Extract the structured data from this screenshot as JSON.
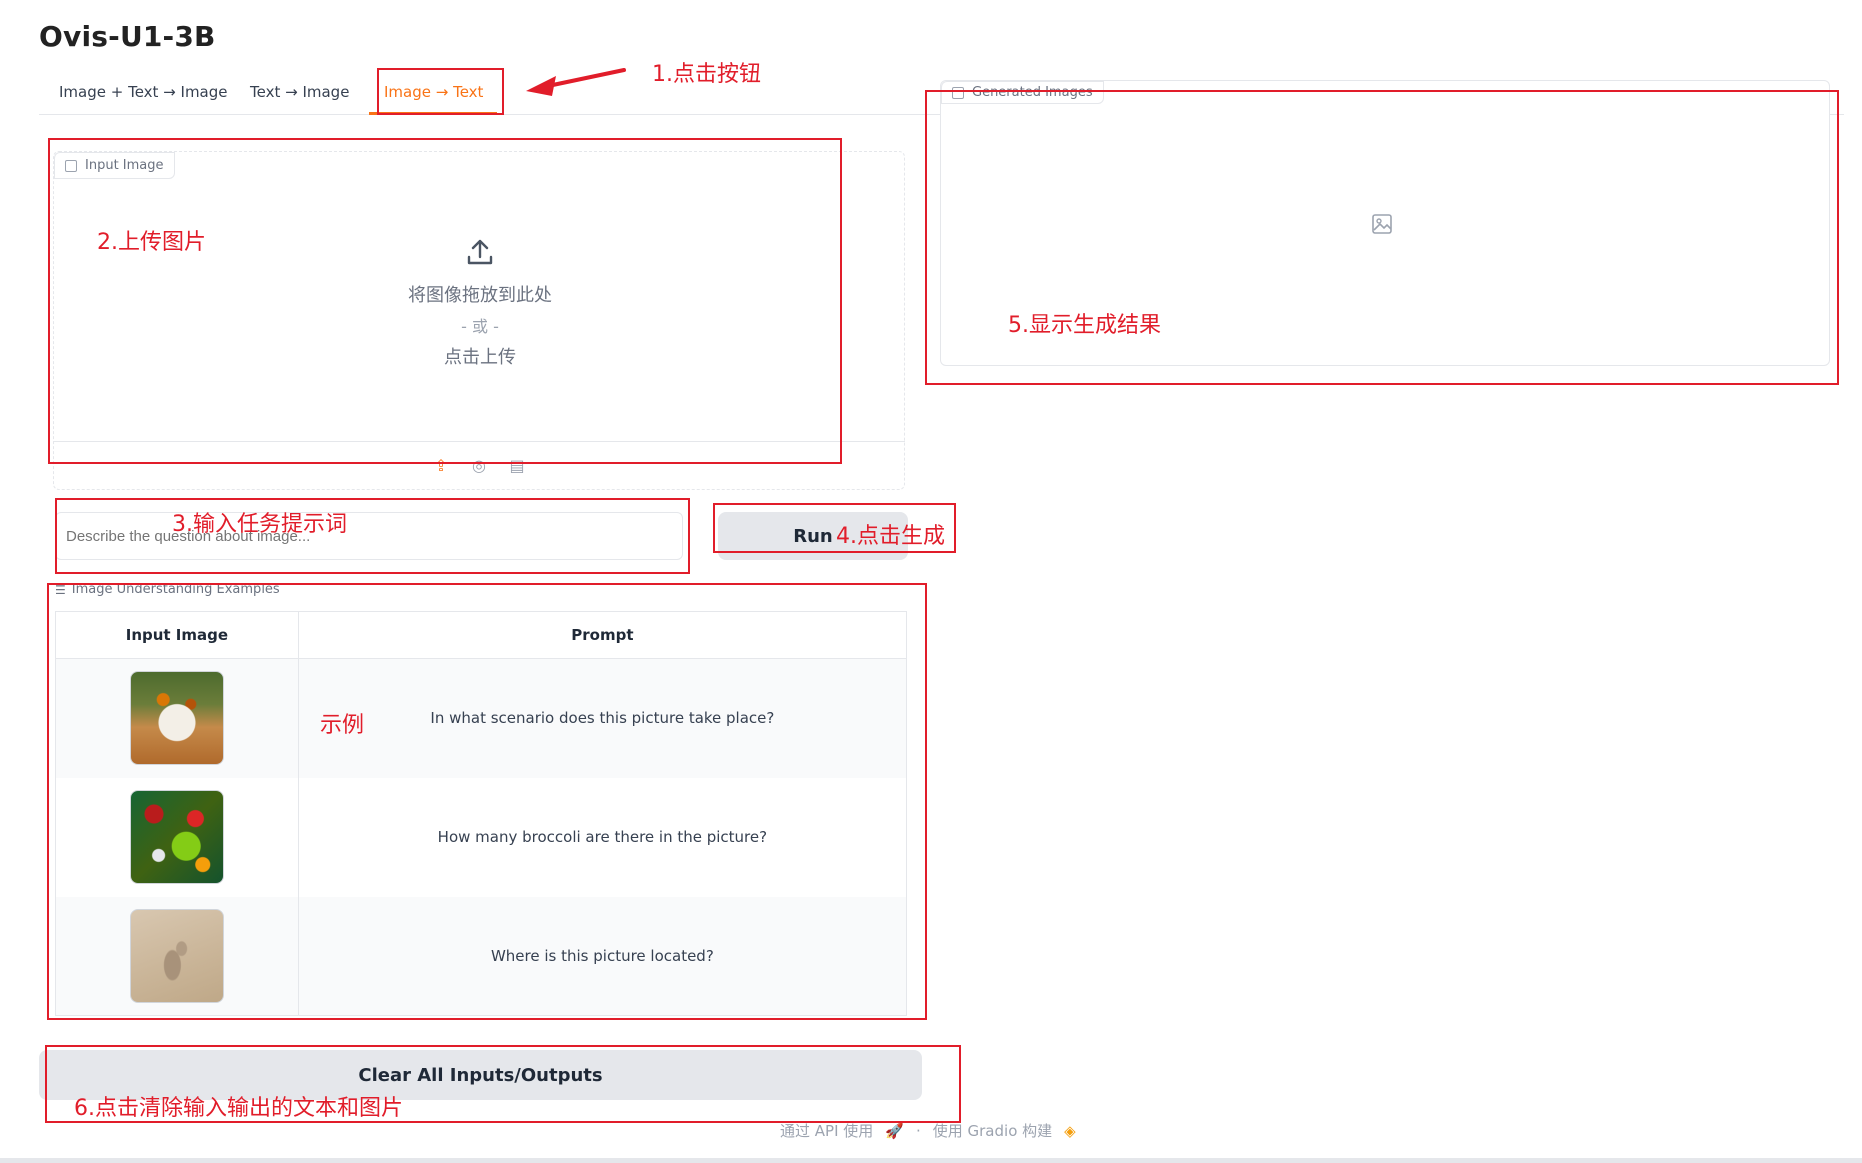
{
  "app": {
    "title": "Ovis-U1-3B"
  },
  "tabs": [
    {
      "label": "Image + Text → Image",
      "active": false
    },
    {
      "label": "Text → Image",
      "active": false
    },
    {
      "label": "Image → Text",
      "active": true
    }
  ],
  "input_panel": {
    "label": "Input Image",
    "drop_text": "将图像拖放到此处",
    "or_text": "- 或 -",
    "click_text": "点击上传"
  },
  "output_panel": {
    "label": "Generated Images"
  },
  "prompt": {
    "placeholder": "Describe the question about image..."
  },
  "run_button": {
    "label": "Run"
  },
  "examples": {
    "label": "Image Understanding Examples",
    "headers": [
      "Input Image",
      "Prompt"
    ],
    "rows": [
      {
        "image": "banquet-table-photo",
        "prompt": "In what scenario does this picture take place?"
      },
      {
        "image": "vegetables-photo",
        "prompt": "How many broccoli are there in the picture?"
      },
      {
        "image": "footprint-in-sand-photo",
        "prompt": "Where is this picture located?"
      }
    ]
  },
  "clear_button": {
    "label": "Clear All Inputs/Outputs"
  },
  "footer": {
    "api_text": "通过 API 使用",
    "separator": "·",
    "built_text": "使用 Gradio 构建"
  },
  "annotations": {
    "step1": "1.点击按钮",
    "step2": "2.上传图片",
    "step3": "3.输入任务提示词",
    "step4": "4.点击生成",
    "step5": "5.显示生成结果",
    "example": "示例",
    "step6": "6.点击清除输入输出的文本和图片"
  },
  "colors": {
    "accent": "#f97316",
    "annotation": "#e11d2a",
    "button_bg": "#e5e7eb"
  }
}
